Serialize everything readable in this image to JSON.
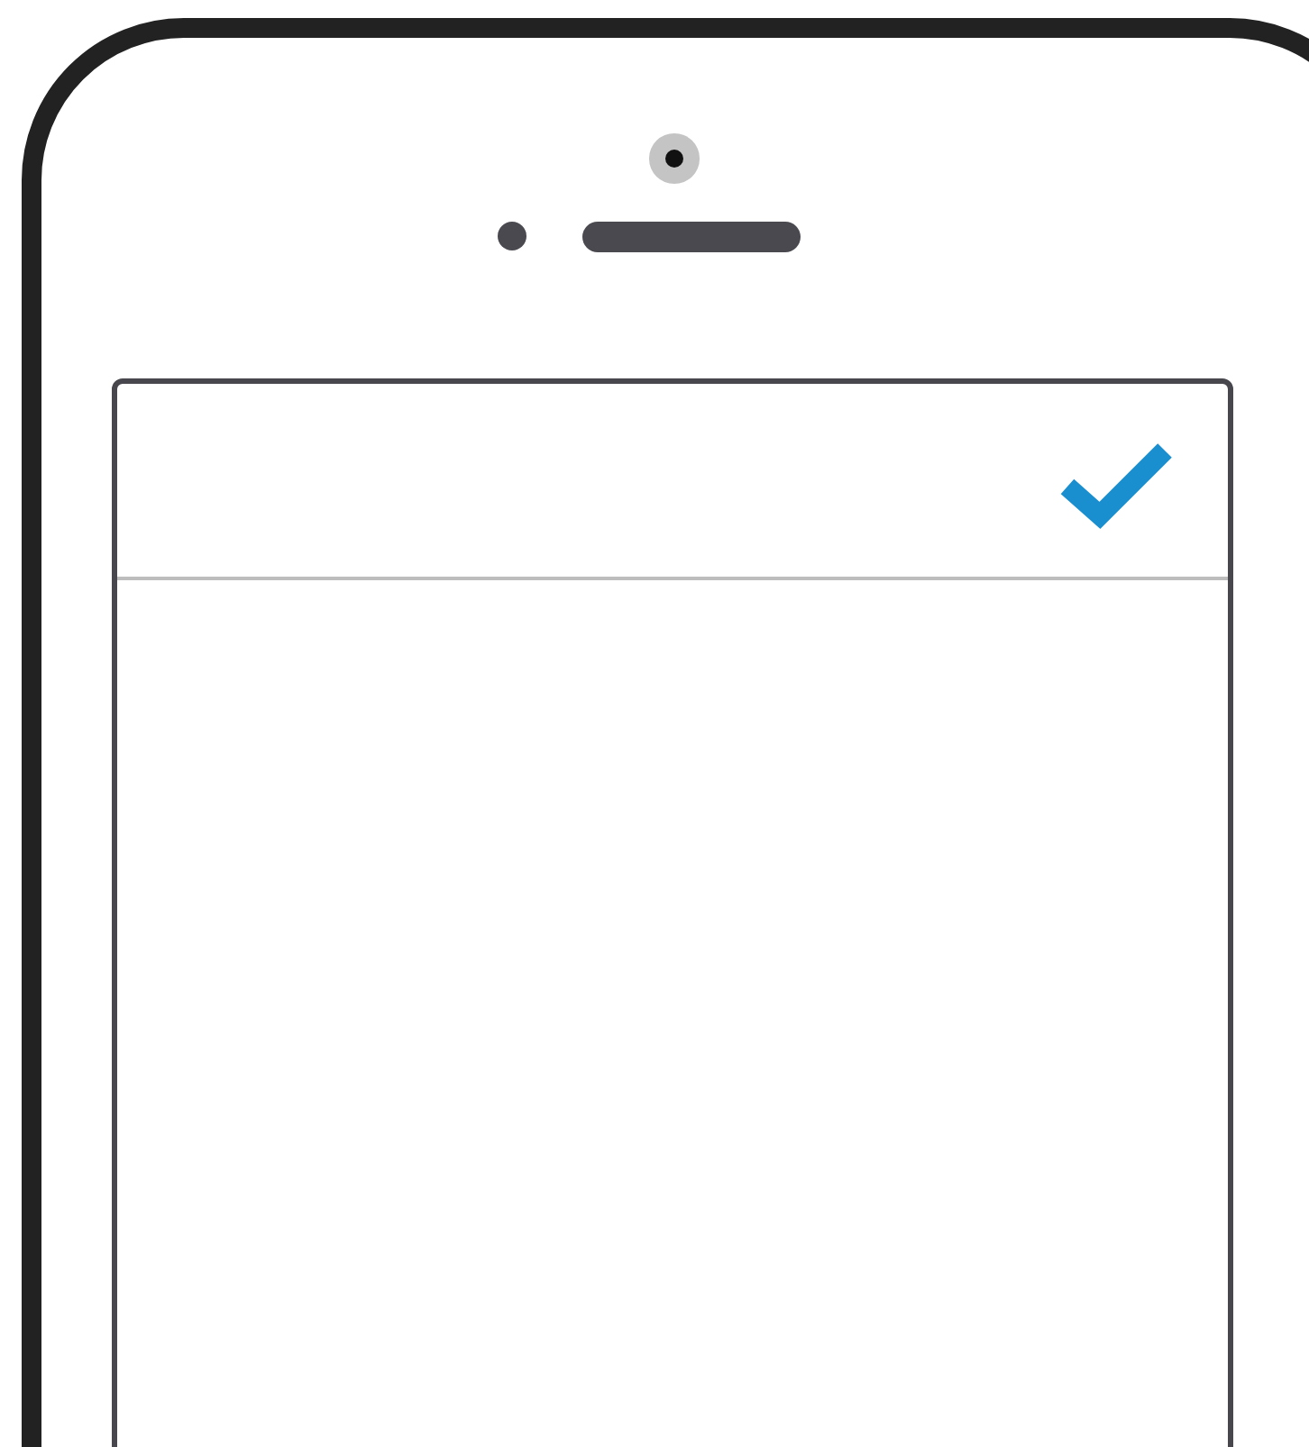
{
  "screen": {
    "header": {
      "action": {
        "kind": "check"
      }
    }
  }
}
